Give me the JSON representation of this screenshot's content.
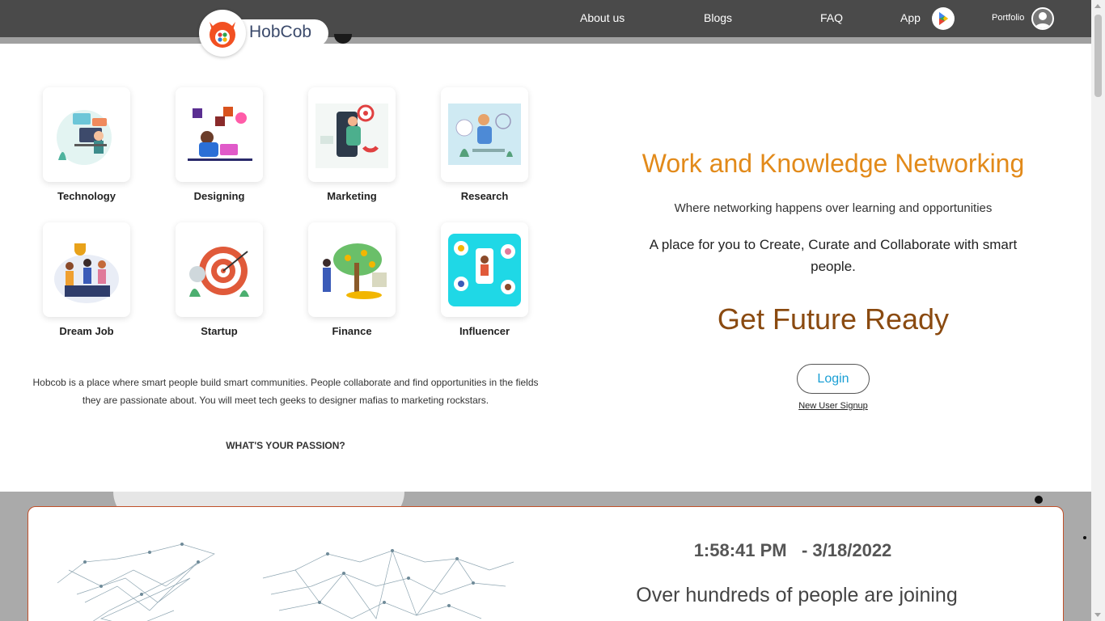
{
  "brand": {
    "name": "HobCob"
  },
  "nav": {
    "about": "About us",
    "blogs": "Blogs",
    "faq": "FAQ",
    "app": "App",
    "portfolio": "Portfolio"
  },
  "categories": [
    {
      "label": "Technology",
      "icon": "technology-illustration"
    },
    {
      "label": "Designing",
      "icon": "designing-illustration"
    },
    {
      "label": "Marketing",
      "icon": "marketing-illustration"
    },
    {
      "label": "Research",
      "icon": "research-illustration"
    },
    {
      "label": "Dream Job",
      "icon": "dream-job-illustration"
    },
    {
      "label": "Startup",
      "icon": "startup-illustration"
    },
    {
      "label": "Finance",
      "icon": "finance-illustration"
    },
    {
      "label": "Influencer",
      "icon": "influencer-illustration"
    }
  ],
  "about": {
    "text": "Hobcob is a place where smart people build smart communities. People collaborate and find opportunities in the fields they are passionate about. You will meet tech geeks to designer mafias to marketing rockstars.",
    "passion": "WHAT'S YOUR PASSION?"
  },
  "hero": {
    "headline": "Work and Knowledge Networking",
    "sub1": "Where networking happens over learning and opportunities",
    "sub2": "A place for you to Create, Curate and Collaborate with smart people.",
    "future": "Get Future Ready",
    "login": "Login",
    "signup": "New User Signup"
  },
  "stats": {
    "time": "1:58:41 PM",
    "date": "- 3/18/2022",
    "joining": "Over hundreds of people are joining"
  },
  "colors": {
    "topbar": "#4a4a4a",
    "headline": "#e28a1a",
    "future": "#8a4a10",
    "login_text": "#1a9fd4",
    "card_border": "#c0502a"
  }
}
